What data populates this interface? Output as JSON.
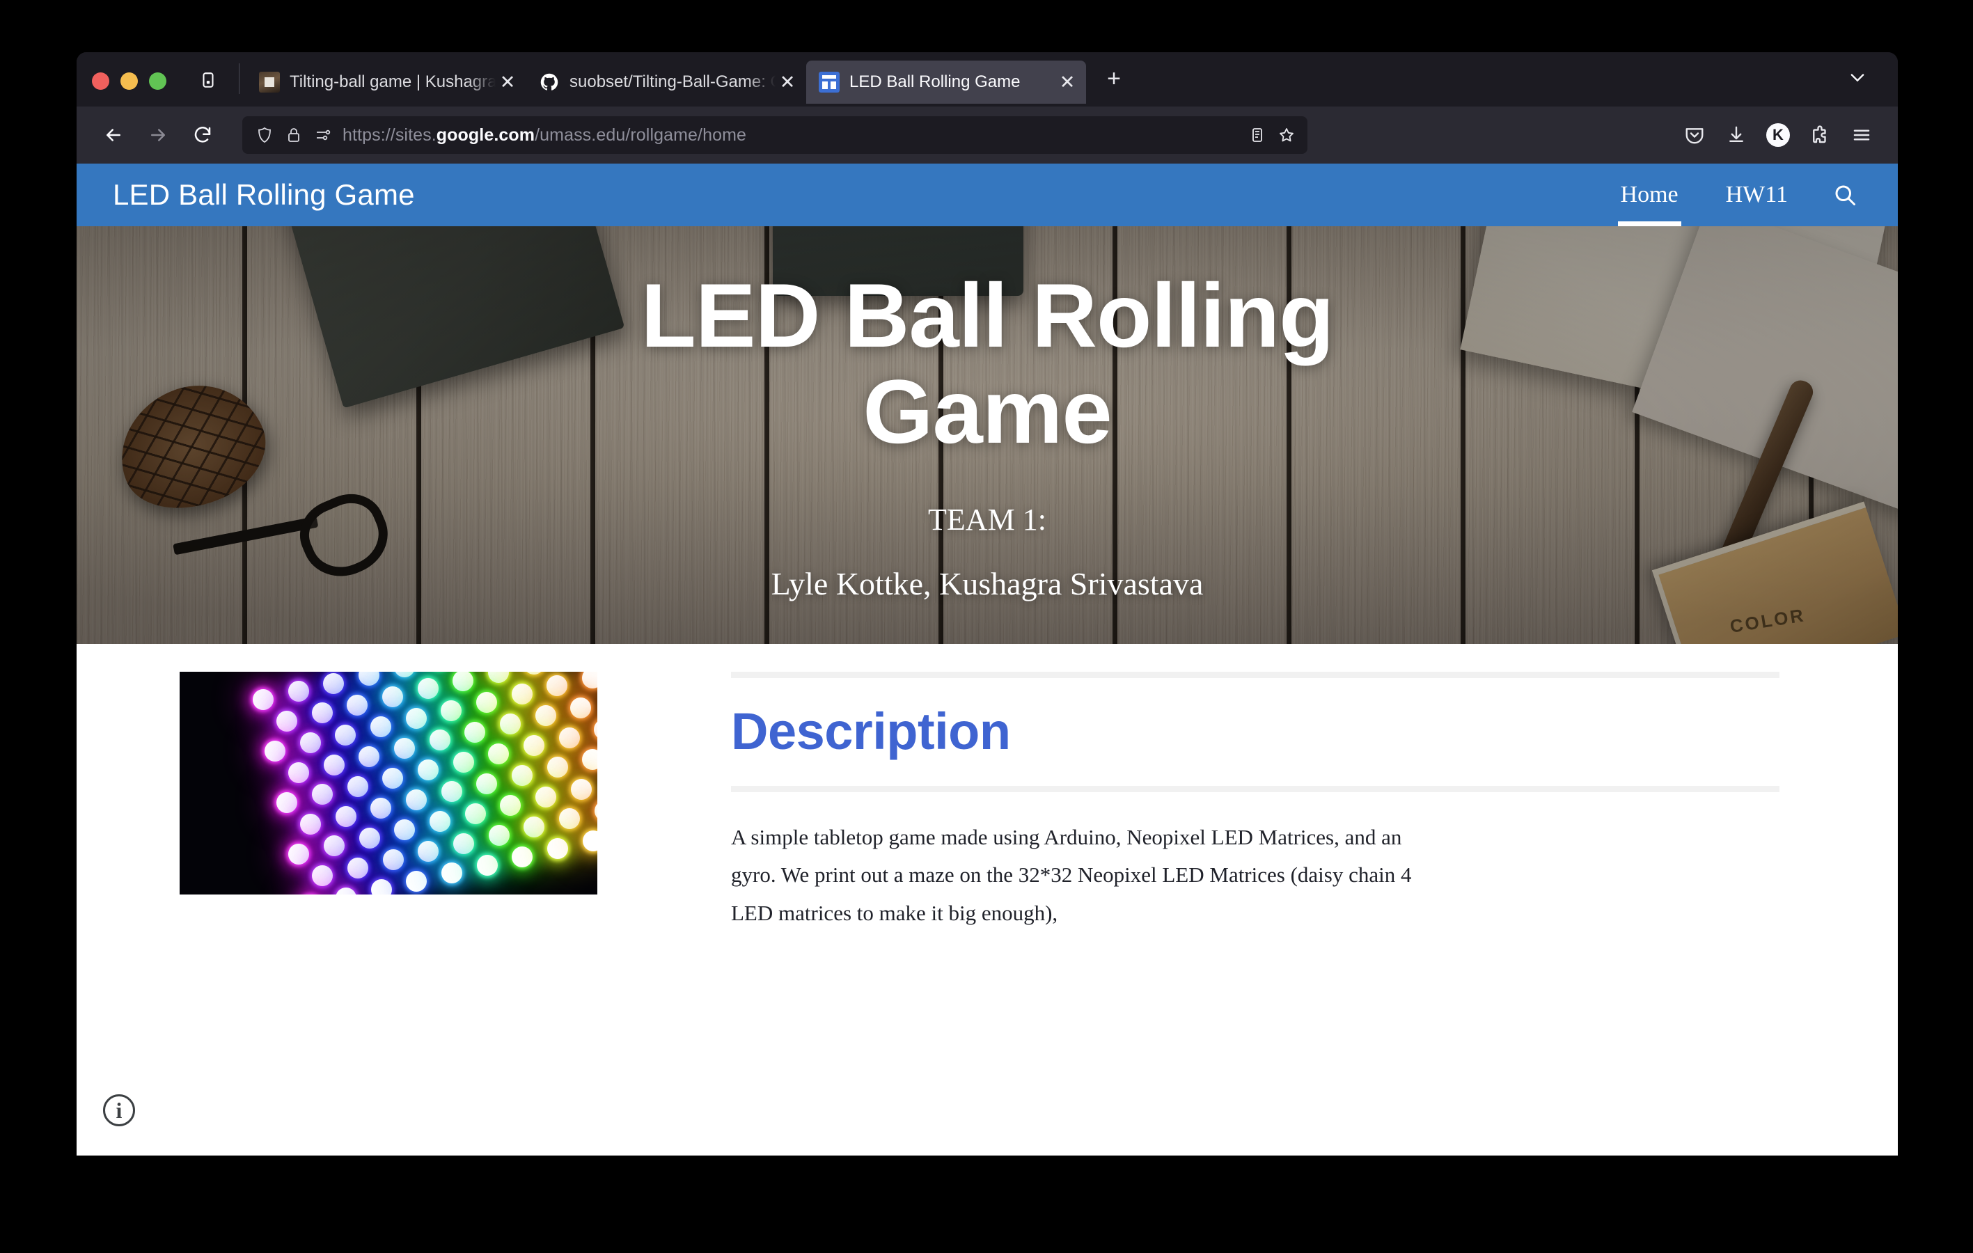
{
  "browser": {
    "window_controls": [
      "close",
      "minimize",
      "maximize"
    ],
    "tablist_icon": "tab-list-icon",
    "tabs": [
      {
        "title": "Tilting-ball game | Kushagra Sriv",
        "favicon": "photo-favicon",
        "active": false,
        "close_label": "✕"
      },
      {
        "title": "suobset/Tilting-Ball-Game: CICS",
        "favicon": "github-icon",
        "active": false,
        "close_label": "✕"
      },
      {
        "title": "LED Ball Rolling Game",
        "favicon": "google-sites-icon",
        "active": true,
        "close_label": "✕"
      }
    ],
    "new_tab_label": "+",
    "tab_chevron_icon": "chevron-down-icon",
    "nav": {
      "back_icon": "back-arrow-icon",
      "forward_icon": "forward-arrow-icon",
      "reload_icon": "reload-icon"
    },
    "urlbar": {
      "shield_icon": "shield-icon",
      "lock_icon": "padlock-icon",
      "permissions_icon": "site-permissions-icon",
      "url_scheme": "https://sites.",
      "url_domain": "google.com",
      "url_path": "/umass.edu/rollgame/home",
      "url_full": "https://sites.google.com/umass.edu/rollgame/home",
      "reader_icon": "reader-view-icon",
      "bookmark_icon": "star-bookmark-icon"
    },
    "toolbar_right": {
      "pocket_icon": "pocket-icon",
      "downloads_icon": "download-icon",
      "account_initial": "K",
      "extensions_icon": "extensions-puzzle-icon",
      "menu_icon": "hamburger-menu-icon"
    }
  },
  "site": {
    "header": {
      "title": "LED Ball Rolling Game",
      "nav_items": [
        {
          "label": "Home",
          "active": true
        },
        {
          "label": "HW11",
          "active": false
        }
      ],
      "search_icon": "search-icon",
      "bar_color": "#3577bf"
    },
    "hero": {
      "title": "LED Ball Rolling Game",
      "team_label": "TEAM 1:",
      "team_members": "Lyle Kottke, Kushagra Srivastava",
      "banner_object_labels": {
        "color_box": "COLOR"
      }
    },
    "main": {
      "image_alt": "neopixel-led-matrix-photo",
      "section_heading": "Description",
      "heading_color": "#3f64d1",
      "body_text": "A simple tabletop game made using Arduino, Neopixel LED Matrices, and an gyro. We print out a maze on the 32*32 Neopixel LED Matrices (daisy chain 4 LED matrices to make it big enough),"
    },
    "info_button_label": "i"
  }
}
